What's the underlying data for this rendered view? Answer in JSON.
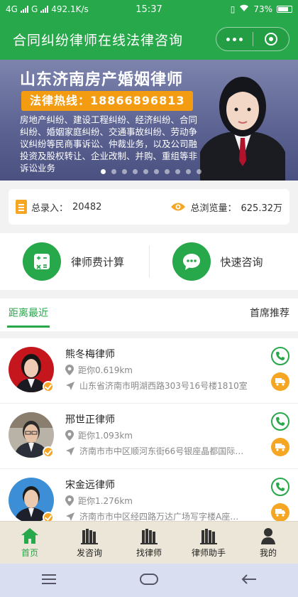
{
  "status": {
    "network": "4G",
    "network2": "G",
    "speed": "492.1K/s",
    "time": "15:37",
    "battery": "73%"
  },
  "titlebar": {
    "title": "合同纠纷律师在线法律咨询"
  },
  "banner": {
    "headline": "山东济南房产婚姻律师",
    "hotline": "法律热线：18866896813",
    "description": "房地产纠纷、建设工程纠纷、经济纠纷、合同纠纷、婚姻家庭纠纷、交通事故纠纷、劳动争议纠纷等民商事诉讼、仲裁业务，以及公司融投资及股权转让、企业改制、并购、重组等非诉讼业务"
  },
  "stats": {
    "total_label": "总录入：",
    "total_value": "20482",
    "views_label": "总浏览量：",
    "views_value": "625.32万"
  },
  "actions": {
    "fee_calc": "律师费计算",
    "quick_consult": "快速咨询"
  },
  "tabs": {
    "nearest": "距离最近",
    "recommend": "首席推荐"
  },
  "lawyers": [
    {
      "name": "熊冬梅律师",
      "distance": "距你0.619km",
      "address": "山东省济南市明湖西路303号16号楼1810室"
    },
    {
      "name": "邢世正律师",
      "distance": "距你1.093km",
      "address": "济南市市中区顺河东街66号银座晶都国际…"
    },
    {
      "name": "宋金远律师",
      "distance": "距你1.276km",
      "address": "济南市市中区经四路万达广场写字楼A座…"
    }
  ],
  "nav": {
    "home": "首页",
    "post_question": "发咨询",
    "find_lawyer": "找律师",
    "assistant": "律师助手",
    "mine": "我的"
  },
  "colors": {
    "brand_green": "#27a84a",
    "accent_orange": "#f5a623"
  }
}
